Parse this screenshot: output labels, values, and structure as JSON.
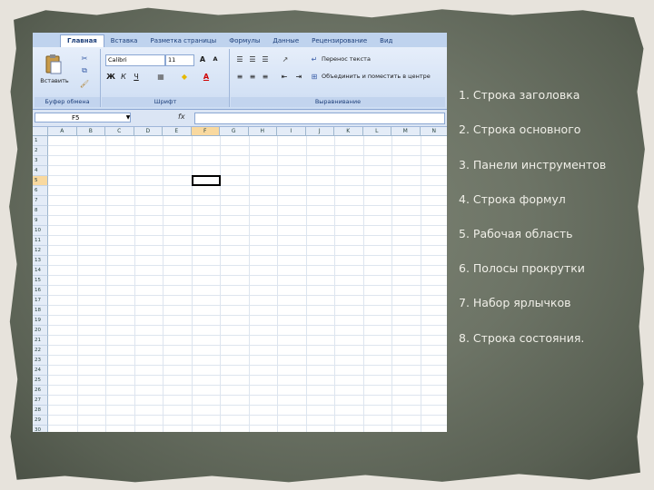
{
  "excel": {
    "ribbon_tabs": [
      "Главная",
      "Вставка",
      "Разметка страницы",
      "Формулы",
      "Данные",
      "Рецензирование",
      "Вид"
    ],
    "active_tab": "Главная",
    "clipboard": {
      "paste_label": "Вставить",
      "group_label": "Буфер обмена"
    },
    "font": {
      "name": "Calibri",
      "size": "11",
      "group_label": "Шрифт",
      "bold": "Ж",
      "italic": "К",
      "underline": "Ч"
    },
    "alignment": {
      "wrap_text": "Перенос текста",
      "merge_center": "Объединить и поместить в центре",
      "group_label": "Выравнивание"
    },
    "name_box": "F5",
    "fx_symbol": "fx",
    "columns": [
      "A",
      "B",
      "C",
      "D",
      "E",
      "F",
      "G",
      "H",
      "I",
      "J",
      "K",
      "L",
      "M",
      "N"
    ],
    "selected_column": "F",
    "rows": [
      "1",
      "2",
      "3",
      "4",
      "5",
      "6",
      "7",
      "8",
      "9",
      "10",
      "11",
      "12",
      "13",
      "14",
      "15",
      "16",
      "17",
      "18",
      "19",
      "20",
      "21",
      "22",
      "23",
      "24",
      "25",
      "26",
      "27",
      "28",
      "29",
      "30"
    ],
    "selected_row": "5"
  },
  "list": {
    "items": [
      "1. Строка заголовка",
      "2. Строка основного",
      "3. Панели инструментов",
      "4. Строка формул",
      "5. Рабочая область",
      "6. Полосы прокрутки",
      "7. Набор ярлычков",
      "8. Строка состояния."
    ]
  }
}
